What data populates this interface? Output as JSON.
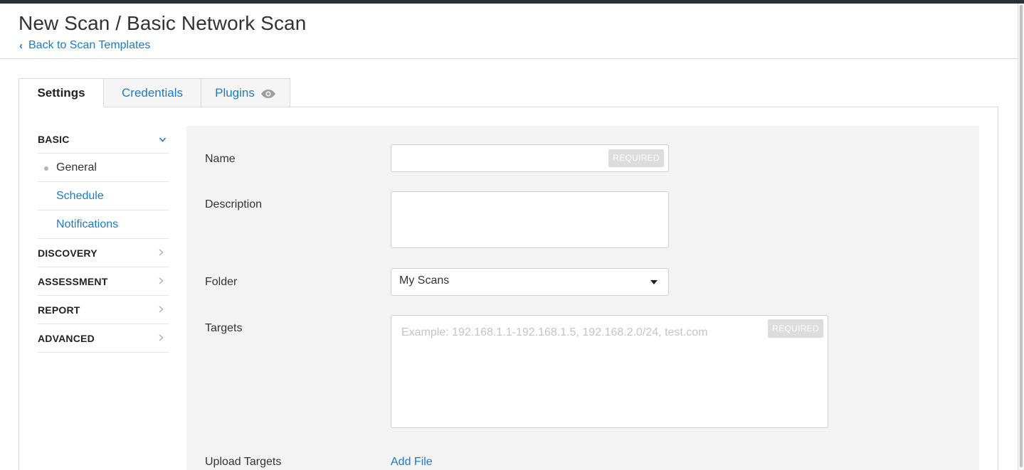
{
  "header": {
    "title": "New Scan / Basic Network Scan",
    "back_link": "Back to Scan Templates",
    "back_icon": "chevron-left-icon"
  },
  "tabs": [
    {
      "label": "Settings",
      "active": true
    },
    {
      "label": "Credentials",
      "active": false
    },
    {
      "label": "Plugins",
      "active": false,
      "icon": "eye-icon"
    }
  ],
  "sidebar": {
    "sections": [
      {
        "label": "BASIC",
        "expanded": true,
        "icon": "chevron-down-icon",
        "items": [
          {
            "label": "General",
            "active": true
          },
          {
            "label": "Schedule",
            "active": false
          },
          {
            "label": "Notifications",
            "active": false
          }
        ]
      },
      {
        "label": "DISCOVERY",
        "expanded": false,
        "icon": "chevron-right-icon"
      },
      {
        "label": "ASSESSMENT",
        "expanded": false,
        "icon": "chevron-right-icon"
      },
      {
        "label": "REPORT",
        "expanded": false,
        "icon": "chevron-right-icon"
      },
      {
        "label": "ADVANCED",
        "expanded": false,
        "icon": "chevron-right-icon"
      }
    ]
  },
  "form": {
    "name": {
      "label": "Name",
      "value": "",
      "badge": "REQUIRED"
    },
    "description": {
      "label": "Description",
      "value": ""
    },
    "folder": {
      "label": "Folder",
      "value": "My Scans"
    },
    "targets": {
      "label": "Targets",
      "value": "",
      "placeholder": "Example: 192.168.1.1-192.168.1.5, 192.168.2.0/24, test.com",
      "badge": "REQUIRED"
    },
    "upload_targets": {
      "label": "Upload Targets",
      "action": "Add File"
    }
  },
  "colors": {
    "link": "#1e7ac1",
    "top_strip": "#263238",
    "form_background": "#f3f3f3",
    "required_badge": "#dcdcdc"
  }
}
